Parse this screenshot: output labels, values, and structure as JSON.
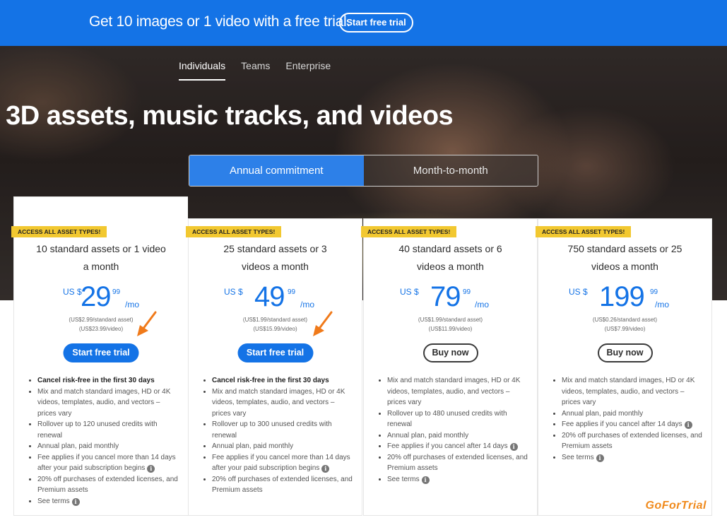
{
  "banner": {
    "text": "Get 10 images or 1 video with a free trial.",
    "button_label": "Start free trial"
  },
  "nav_tabs": [
    {
      "label": "Individuals",
      "active": true
    },
    {
      "label": "Teams",
      "active": false
    },
    {
      "label": "Enterprise",
      "active": false
    }
  ],
  "hero": {
    "title": ", 3D assets, music tracks, and videos"
  },
  "billing_toggle": {
    "annual_label": "Annual commitment",
    "monthly_label": "Month-to-month",
    "selected": "annual"
  },
  "plans": [
    {
      "badge": "ACCESS ALL ASSET TYPES!",
      "title_line1": "10 standard assets or 1 video",
      "title_line2": "a month",
      "currency": "US $",
      "price": "29",
      "cents": "99",
      "per": "/mo",
      "per_asset": "(US$2.99/standard asset)",
      "per_video": "(US$23.99/video)",
      "cta": "Start free trial",
      "features": [
        {
          "text": "Cancel risk-free in the first 30 days",
          "bold": true
        },
        {
          "text": "Mix and match standard images, HD or 4K videos, templates, audio, and vectors – prices vary"
        },
        {
          "text": "Rollover up to 120 unused credits with renewal"
        },
        {
          "text": "Annual plan, paid monthly"
        },
        {
          "text": "Fee applies if you cancel more than 14 days after your paid subscription begins",
          "info": true
        },
        {
          "text": "20% off purchases of extended licenses, and Premium assets"
        },
        {
          "text": "See terms",
          "info": true
        }
      ]
    },
    {
      "badge": "ACCESS ALL ASSET TYPES!",
      "title_line1": "25 standard assets or 3",
      "title_line2": "videos a month",
      "currency": "US $",
      "price": "49",
      "cents": "99",
      "per": "/mo",
      "per_asset": "(US$1.99/standard asset)",
      "per_video": "(US$15.99/video)",
      "cta": "Start free trial",
      "features": [
        {
          "text": "Cancel risk-free in the first 30 days",
          "bold": true
        },
        {
          "text": "Mix and match standard images, HD or 4K videos, templates, audio, and vectors – prices vary"
        },
        {
          "text": "Rollover up to 300 unused credits with renewal"
        },
        {
          "text": "Annual plan, paid monthly"
        },
        {
          "text": "Fee applies if you cancel more than 14 days after your paid subscription begins",
          "info": true
        },
        {
          "text": "20% off purchases of extended licenses, and Premium assets"
        }
      ]
    },
    {
      "badge": "ACCESS ALL ASSET TYPES!",
      "title_line1": "40 standard assets or 6",
      "title_line2": "videos a month",
      "currency": "US $",
      "price": "79",
      "cents": "99",
      "per": "/mo",
      "per_asset": "(US$1.99/standard asset)",
      "per_video": "(US$11.99/video)",
      "cta": "Buy now",
      "features": [
        {
          "text": "Mix and match standard images, HD or 4K videos, templates, audio, and vectors – prices vary"
        },
        {
          "text": "Rollover up to 480 unused credits with renewal"
        },
        {
          "text": "Annual plan, paid monthly"
        },
        {
          "text": "Fee applies if you cancel after 14 days",
          "info": true
        },
        {
          "text": "20% off purchases of extended licenses, and Premium assets"
        },
        {
          "text": "See terms",
          "info": true
        }
      ]
    },
    {
      "badge": "ACCESS ALL ASSET TYPES!",
      "title_line1": "750 standard assets or 25",
      "title_line2": "videos a month",
      "currency": "US $",
      "price": "199",
      "cents": "99",
      "per": "/mo",
      "per_asset": "(US$0.26/standard asset)",
      "per_video": "(US$7.99/video)",
      "cta": "Buy now",
      "features": [
        {
          "text": "Mix and match standard images, HD or 4K videos, templates, audio, and vectors – prices vary"
        },
        {
          "text": "Annual plan, paid monthly"
        },
        {
          "text": "Fee applies if you cancel after 14 days",
          "info": true
        },
        {
          "text": "20% off purchases of extended licenses, and Premium assets"
        },
        {
          "text": "See terms",
          "info": true
        }
      ]
    }
  ],
  "watermark": "GoForTrial",
  "colors": {
    "brand_blue": "#1473e6",
    "badge_yellow": "#f2c830",
    "arrow_orange": "#f07a1a"
  }
}
